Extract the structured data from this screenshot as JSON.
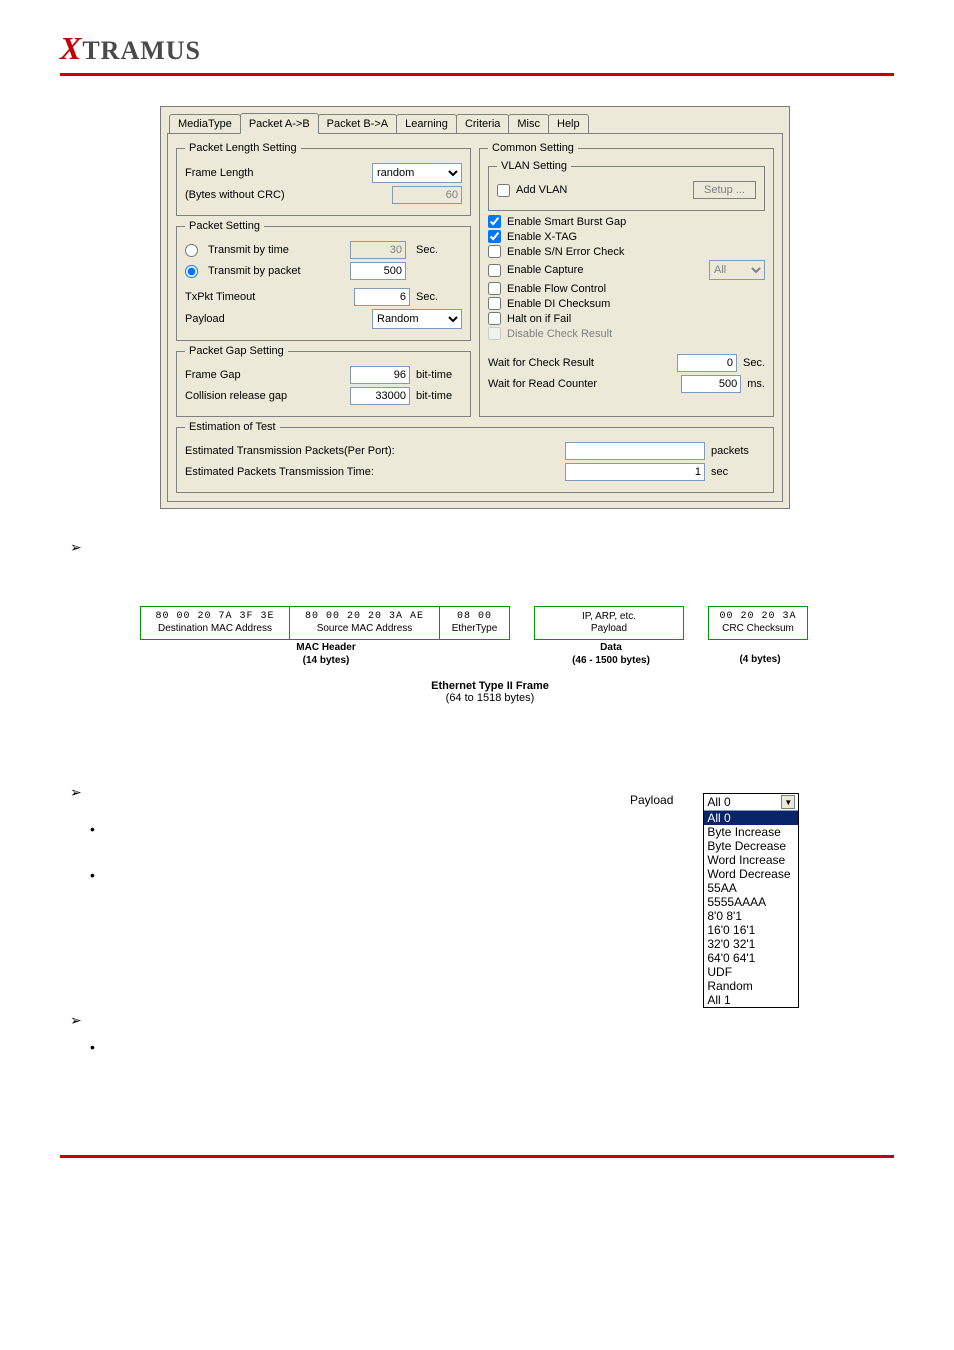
{
  "brand": {
    "x": "X",
    "rest": "TRAMUS"
  },
  "tabs": [
    "MediaType",
    "Packet A->B",
    "Packet B->A",
    "Learning",
    "Criteria",
    "Misc",
    "Help"
  ],
  "active_tab_index": 1,
  "packet_length": {
    "legend": "Packet Length Setting",
    "frame_length_label": "Frame Length",
    "frame_length_select": "random",
    "bytes_label": "(Bytes without CRC)",
    "bytes_value": "60"
  },
  "packet_setting": {
    "legend": "Packet Setting",
    "transmit_time_label": "Transmit by time",
    "transmit_time_value": "30",
    "transmit_time_unit": "Sec.",
    "transmit_packet_label": "Transmit by packet",
    "transmit_packet_value": "500",
    "txpkt_timeout_label": "TxPkt Timeout",
    "txpkt_timeout_value": "6",
    "txpkt_timeout_unit": "Sec.",
    "payload_label": "Payload",
    "payload_select": "Random"
  },
  "packet_gap": {
    "legend": "Packet Gap Setting",
    "frame_gap_label": "Frame Gap",
    "frame_gap_value": "96",
    "frame_gap_unit": "bit-time",
    "collision_label": "Collision release gap",
    "collision_value": "33000",
    "collision_unit": "bit-time"
  },
  "common": {
    "legend": "Common Setting",
    "vlan_legend": "VLAN Setting",
    "add_vlan_label": "Add VLAN",
    "setup_btn": "Setup ...",
    "checks": [
      {
        "label": "Enable Smart Burst Gap",
        "checked": true,
        "disabled": false
      },
      {
        "label": "Enable X-TAG",
        "checked": true,
        "disabled": false
      },
      {
        "label": "Enable S/N Error Check",
        "checked": false,
        "disabled": false
      },
      {
        "label": "Enable Capture",
        "checked": false,
        "disabled": false,
        "has_select": true,
        "select": "All"
      },
      {
        "label": "Enable Flow Control",
        "checked": false,
        "disabled": false
      },
      {
        "label": "Enable DI Checksum",
        "checked": false,
        "disabled": false
      },
      {
        "label": "Halt on if Fail",
        "checked": false,
        "disabled": false
      },
      {
        "label": "Disable Check Result",
        "checked": false,
        "disabled": true
      }
    ],
    "wait_check_label": "Wait for Check Result",
    "wait_check_value": "0",
    "wait_check_unit": "Sec.",
    "wait_read_label": "Wait for Read Counter",
    "wait_read_value": "500",
    "wait_read_unit": "ms."
  },
  "estimation": {
    "legend": "Estimation of Test",
    "packets_label": "Estimated Transmission Packets(Per Port):",
    "packets_value": "",
    "packets_unit": "packets",
    "time_label": "Estimated Packets Transmission Time:",
    "time_value": "1",
    "time_unit": "sec"
  },
  "frame_diagram": {
    "dest_hex": "80 00 20 7A 3F 3E",
    "dest_label": "Destination MAC Address",
    "src_hex": "80 00 20 20 3A AE",
    "src_label": "Source MAC Address",
    "ethertype_hex": "08 00",
    "ethertype_label": "EtherType",
    "payload_top": "IP, ARP, etc.",
    "payload_label": "Payload",
    "crc_hex": "00 20 20 3A",
    "crc_label": "CRC Checksum",
    "mac_header": "MAC Header",
    "mac_header_bytes": "(14 bytes)",
    "data_label": "Data",
    "data_bytes": "(46 - 1500 bytes)",
    "crc_bytes": "(4 bytes)",
    "title": "Ethernet Type II Frame",
    "title_bytes": "(64 to 1518 bytes)"
  },
  "payload_dropdown": {
    "label": "Payload",
    "selected": "All 0",
    "options": [
      "All 0",
      "Byte Increase",
      "Byte Decrease",
      "Word Increase",
      "Word Decrease",
      "55AA",
      "5555AAAA",
      "8'0 8'1",
      "16'0 16'1",
      "32'0 32'1",
      "64'0 64'1",
      "UDF",
      "Random",
      "All 1"
    ]
  }
}
